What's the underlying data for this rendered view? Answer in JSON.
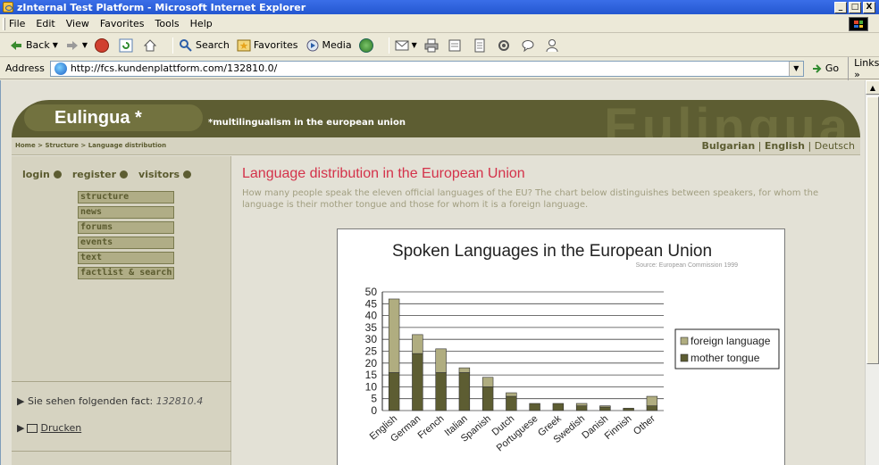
{
  "window": {
    "title": "zInternal Test Platform - Microsoft Internet Explorer",
    "controls": [
      "_",
      "□",
      "X"
    ]
  },
  "menu": [
    "File",
    "Edit",
    "View",
    "Favorites",
    "Tools",
    "Help"
  ],
  "toolbar": {
    "back": "Back",
    "search": "Search",
    "favorites": "Favorites",
    "media": "Media"
  },
  "address": {
    "label": "Address",
    "url": "http://fcs.kundenplattform.com/132810.0/",
    "go": "Go",
    "links": "Links"
  },
  "site": {
    "logo": "Eulingua *",
    "tagline": "*multilingualism in the european union",
    "watermark": "Eulingua",
    "breadcrumb": "Home > Structure > Language distribution",
    "languages": [
      "Bulgarian",
      "English",
      "Deutsch"
    ],
    "login": [
      "login",
      "register",
      "visitors"
    ],
    "nav": [
      "structure",
      "news",
      "forums",
      "events",
      "text",
      "factlist & search"
    ],
    "fact_label": "Sie sehen folgenden fact:",
    "fact_id": "132810.4",
    "print_label": "Drucken"
  },
  "main": {
    "heading": "Language distribution in the European Union",
    "intro": "How many people speak the eleven official languages of the EU? The chart below distinguishes between speakers, for whom the language is their mother tongue and those for whom it is a foreign language."
  },
  "chart_data": {
    "type": "bar",
    "stacked": true,
    "title": "Spoken Languages in the European Union",
    "subtitle": "Source: European Commission 1999",
    "categories": [
      "English",
      "German",
      "French",
      "Italian",
      "Spanish",
      "Dutch",
      "Portuguese",
      "Greek",
      "Swedish",
      "Danish",
      "Finnish",
      "Other"
    ],
    "series": [
      {
        "name": "mother tongue",
        "color": "#5d5d32",
        "values": [
          16,
          24,
          16,
          16,
          10,
          6,
          3,
          3,
          2,
          1.5,
          1,
          2
        ]
      },
      {
        "name": "foreign language",
        "color": "#b0ad80",
        "values": [
          31,
          8,
          10,
          2,
          4,
          1.5,
          0,
          0,
          1,
          0.5,
          0,
          4
        ]
      }
    ],
    "yticks": [
      0,
      5,
      10,
      15,
      20,
      25,
      30,
      35,
      40,
      45,
      50
    ],
    "ylim": [
      0,
      50
    ],
    "legend": "right",
    "grid": true
  }
}
